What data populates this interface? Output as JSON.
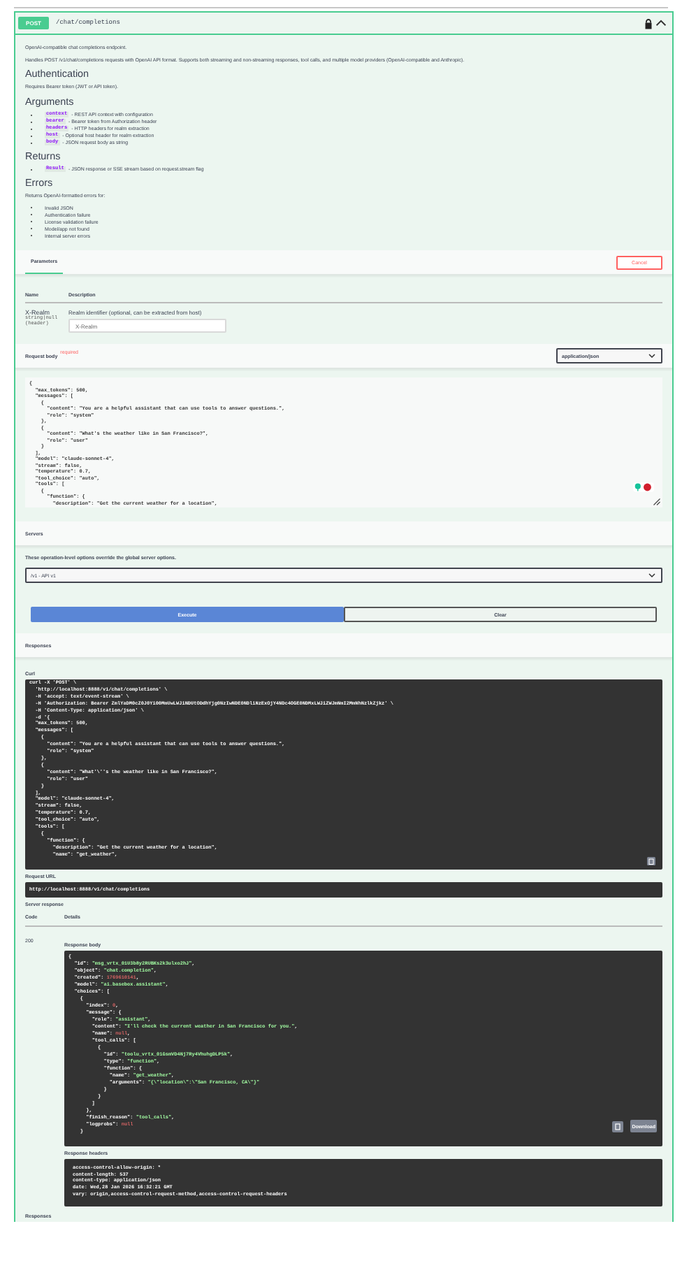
{
  "operation": {
    "method": "POST",
    "path": "/chat/completions",
    "locked": true,
    "expanded": true
  },
  "summary": [
    "OpenAI-compatible chat completions endpoint.",
    "Handles POST /v1/chat/completions requests with OpenAI API format. Supports both streaming and non-streaming responses, tool calls, and multiple model providers (OpenAI-compatible and Anthropic)."
  ],
  "authentication": {
    "heading": "Authentication",
    "text": "Requires Bearer token (JWT or API token)."
  },
  "arguments": {
    "heading": "Arguments",
    "items": [
      {
        "name": "context",
        "text": "- REST API context with configuration"
      },
      {
        "name": "bearer",
        "text": "- Bearer token from Authorization header"
      },
      {
        "name": "headers",
        "text": "- HTTP headers for realm extraction"
      },
      {
        "name": "host",
        "text": "- Optional host header for realm extraction"
      },
      {
        "name": "body",
        "text": "- JSON request body as string"
      }
    ]
  },
  "returns": {
    "heading": "Returns",
    "items": [
      {
        "name": "Result",
        "text": "- JSON response or SSE stream based on request.stream flag"
      }
    ]
  },
  "errors": {
    "heading": "Errors",
    "intro": "Returns OpenAI-formatted errors for:",
    "items": [
      "Invalid JSON",
      "Authentication failure",
      "License validation failure",
      "Model/app not found",
      "Internal server errors"
    ]
  },
  "tabs": [
    {
      "label": "Parameters",
      "selected": true
    }
  ],
  "cancel": "Cancel",
  "parameters": {
    "columns": [
      "Name",
      "Description"
    ],
    "rows": [
      {
        "name": "X-Realm",
        "type": "string|null",
        "location": "(header)",
        "description": "Realm identifier (optional, can be extracted from host)",
        "placeholder": "X-Realm"
      }
    ]
  },
  "request_body": {
    "label": "Request body",
    "required": "required",
    "content_type": "application/json",
    "lines": [
      "{",
      "  \"max_tokens\": 500,",
      "  \"messages\": [",
      "    {",
      "      \"content\": \"You are a helpful assistant that can use tools to answer questions.\",",
      "      \"role\": \"system\"",
      "    },",
      "    {",
      "      \"content\": \"What's the weather like in San Francisco?\",",
      "      \"role\": \"user\"",
      "    }",
      "  ],",
      "  \"model\": \"claude-sonnet-4\",",
      "  \"stream\": false,",
      "  \"temperature\": 0.7,",
      "  \"tool_choice\": \"auto\",",
      "  \"tools\": [",
      "    {",
      "      \"function\": {",
      "        \"description\": \"Get the current weather for a location\","
    ]
  },
  "servers": {
    "heading": "Servers",
    "note": "These operation-level options override the global server options.",
    "selected": "/v1 - API v1"
  },
  "actions": {
    "execute": "Execute",
    "clear": "Clear"
  },
  "responses": {
    "heading": "Responses",
    "curl_label": "Curl",
    "curl": [
      "curl -X 'POST' \\",
      "  'http://localhost:8888/v1/chat/completions' \\",
      "  -H 'accept: text/event-stream' \\",
      "  -H 'Authorization: Bearer ZmlYaDM0cZ0J0Yi00MmUwLWJiNDUtODdhYjg0NzIwNDE0NDliNzExOjY4NDc4OGE0NDMxLWJiZWJmNmI2MmNhNzlkZjkz' \\",
      "  -H 'Content-Type: application/json' \\",
      "  -d '{",
      "  \"max_tokens\": 500,",
      "  \"messages\": [",
      "    {",
      "      \"content\": \"You are a helpful assistant that can use tools to answer questions.\",",
      "      \"role\": \"system\"",
      "    },",
      "    {",
      "      \"content\": \"What'\\''s the weather like in San Francisco?\",",
      "      \"role\": \"user\"",
      "    }",
      "  ],",
      "  \"model\": \"claude-sonnet-4\",",
      "  \"stream\": false,",
      "  \"temperature\": 0.7,",
      "  \"tool_choice\": \"auto\",",
      "  \"tools\": [",
      "    {",
      "      \"function\": {",
      "        \"description\": \"Get the current weather for a location\",",
      "        \"name\": \"get_weather\","
    ],
    "request_url_label": "Request URL",
    "request_url": "http://localhost:8888/v1/chat/completions",
    "server_response_label": "Server response",
    "columns": [
      "Code",
      "Details"
    ],
    "code": "200",
    "body_label": "Response body",
    "body": [
      "{",
      "  \"id\": \"msg_vrtx_01U3b8y2RUBKs2k3ulxo2hJ\",",
      "  \"object\": \"chat.completion\",",
      "  \"created\": 1769610141,",
      "  \"model\": \"ai.basebox.assistant\",",
      "  \"choices\": [",
      "    {",
      "      \"index\": 0,",
      "      \"message\": {",
      "        \"role\": \"assistant\",",
      "        \"content\": \"I'll check the current weather in San Francisco for you.\",",
      "        \"name\": null,",
      "        \"tool_calls\": [",
      "          {",
      "            \"id\": \"toolu_vrtx_01GsmVD4Nj7Ry4VhuhgDLP5k\",",
      "            \"type\": \"function\",",
      "            \"function\": {",
      "              \"name\": \"get_weather\",",
      "              \"arguments\": \"{\\\"location\\\":\\\"San Francisco, CA\\\"}\"",
      "            }",
      "          }",
      "        ]",
      "      },",
      "      \"finish_reason\": \"tool_calls\",",
      "      \"logprobs\": null",
      "    }"
    ],
    "download": "Download",
    "headers_label": "Response headers",
    "headers": [
      "access-control-allow-origin: *",
      "content-length: 537",
      "content-type: application/json",
      "date: Wed,28 Jan 2026 16:32:21 GMT",
      "vary: origin,access-control-request-method,access-control-request-headers"
    ],
    "footer_heading": "Responses"
  }
}
